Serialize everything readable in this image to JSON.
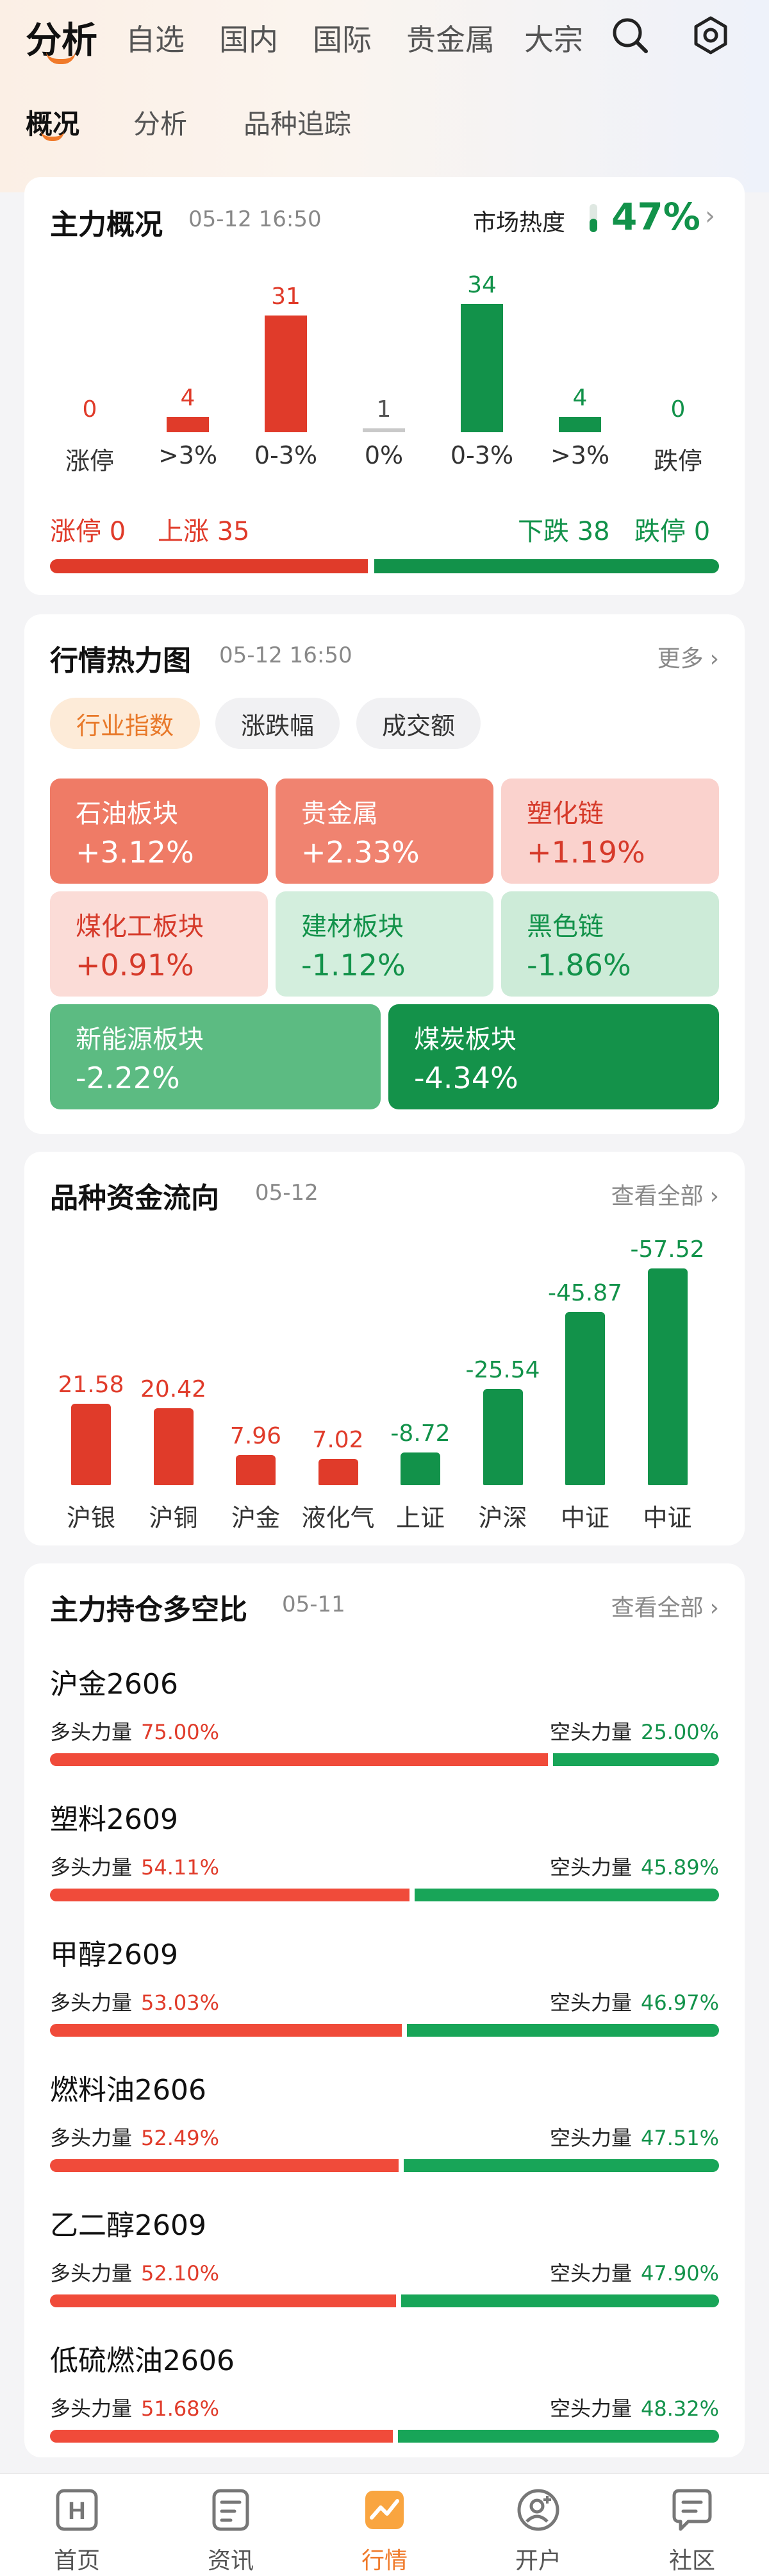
{
  "header": {
    "tabs": [
      "分析",
      "自选",
      "国内",
      "国际",
      "贵金属",
      "大宗"
    ],
    "active_tab": "分析",
    "subtabs": [
      "概况",
      "分析",
      "品种追踪"
    ],
    "active_subtab": "概况"
  },
  "overview": {
    "title": "主力概况",
    "time": "05-12 16:50",
    "heat_label": "市场热度",
    "heat_value": "47%",
    "bars": [
      {
        "label": "涨停",
        "value": "0",
        "count": 0,
        "color": "red"
      },
      {
        "label": ">3%",
        "value": "4",
        "count": 4,
        "color": "red"
      },
      {
        "label": "0-3%",
        "value": "31",
        "count": 31,
        "color": "red"
      },
      {
        "label": "0%",
        "value": "1",
        "count": 1,
        "color": "grey"
      },
      {
        "label": "0-3%",
        "value": "34",
        "count": 34,
        "color": "green"
      },
      {
        "label": ">3%",
        "value": "4",
        "count": 4,
        "color": "green"
      },
      {
        "label": "跌停",
        "value": "0",
        "count": 0,
        "color": "green"
      }
    ],
    "limit_up_text": "涨停 0",
    "rise_text": "上涨 35",
    "fall_text": "下跌 38",
    "limit_down_text": "跌停 0",
    "rise_count": 35,
    "fall_count": 38
  },
  "heatmap": {
    "title": "行情热力图",
    "time": "05-12 16:50",
    "more": "更多",
    "pills": [
      "行业指数",
      "涨跌幅",
      "成交额"
    ],
    "active_pill": "行业指数",
    "tiles": [
      {
        "name": "石油板块",
        "change": "+3.12%",
        "bg": "#ef7b66",
        "fg": "#ffffff"
      },
      {
        "name": "贵金属",
        "change": "+2.33%",
        "bg": "#f08370",
        "fg": "#ffffff"
      },
      {
        "name": "塑化链",
        "change": "+1.19%",
        "bg": "#fad2cd",
        "fg": "#d63a2a"
      },
      {
        "name": "煤化工板块",
        "change": "+0.91%",
        "bg": "#fbdcd7",
        "fg": "#d63a2a"
      },
      {
        "name": "建材板块",
        "change": "-1.12%",
        "bg": "#d3eedd",
        "fg": "#12924a"
      },
      {
        "name": "黑色链",
        "change": "-1.86%",
        "bg": "#cdebd8",
        "fg": "#12924a"
      },
      {
        "name": "新能源板块",
        "change": "-2.22%",
        "bg": "#5cbb82",
        "fg": "#ffffff"
      },
      {
        "name": "煤炭板块",
        "change": "-4.34%",
        "bg": "#14924a",
        "fg": "#ffffff"
      }
    ]
  },
  "flow": {
    "title": "品种资金流向",
    "time": "05-12",
    "more": "查看全部"
  },
  "positions": {
    "title": "主力持仓多空比",
    "time": "05-11",
    "more": "查看全部",
    "long_label": "多头力量",
    "short_label": "空头力量",
    "items": [
      {
        "name": "沪金2606",
        "long": "75.00%",
        "short": "25.00%",
        "long_pct": 75.0
      },
      {
        "name": "塑料2609",
        "long": "54.11%",
        "short": "45.89%",
        "long_pct": 54.11
      },
      {
        "name": "甲醇2609",
        "long": "53.03%",
        "short": "46.97%",
        "long_pct": 53.03
      },
      {
        "name": "燃料油2606",
        "long": "52.49%",
        "short": "47.51%",
        "long_pct": 52.49
      },
      {
        "name": "乙二醇2609",
        "long": "52.10%",
        "short": "47.90%",
        "long_pct": 52.1
      },
      {
        "name": "低硫燃油2606",
        "long": "51.68%",
        "short": "48.32%",
        "long_pct": 51.68
      }
    ]
  },
  "nav": {
    "items": [
      "首页",
      "资讯",
      "行情",
      "开户",
      "社区"
    ],
    "active": "行情"
  },
  "colors": {
    "red": "#e03b2a",
    "green": "#12924a",
    "accent": "#f07a2a"
  },
  "chart_data": {
    "type": "bar",
    "categories": [
      "沪银",
      "沪铜",
      "沪金",
      "液化气",
      "上证",
      "沪深",
      "中证",
      "中证"
    ],
    "values": [
      21.58,
      20.42,
      7.96,
      7.02,
      -8.72,
      -25.54,
      -45.87,
      -57.52
    ],
    "value_labels": [
      "21.58",
      "20.42",
      "7.96",
      "7.02",
      "-8.72",
      "-25.54",
      "-45.87",
      "-57.52"
    ]
  }
}
